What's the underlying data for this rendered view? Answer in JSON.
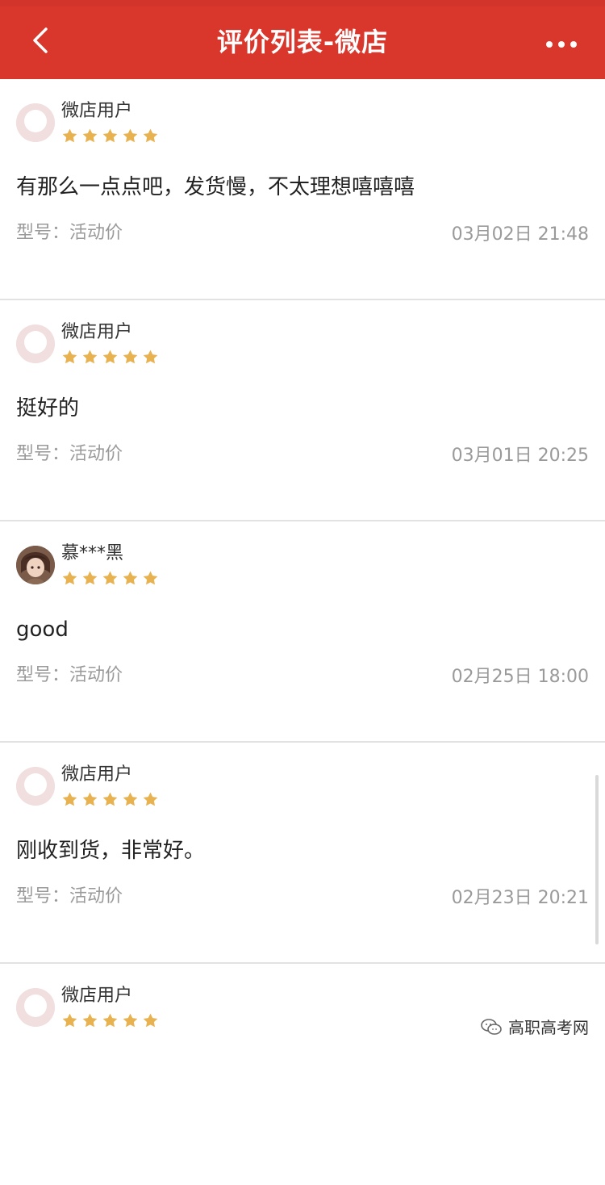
{
  "header": {
    "title": "评价列表-微店",
    "back_icon": "chevron-left-icon",
    "more_icon": "more-horizontal-icon",
    "bg_color": "#d9362c"
  },
  "reviews": [
    {
      "username": "微店用户",
      "rating": 5,
      "content": "有那么一点点吧，发货慢，不太理想嘻嘻嘻",
      "model": "型号：活动价",
      "date": "03月02日 21:48",
      "avatar": "default-avatar"
    },
    {
      "username": "微店用户",
      "rating": 5,
      "content": "挺好的",
      "model": "型号：活动价",
      "date": "03月01日 20:25",
      "avatar": "default-avatar"
    },
    {
      "username": "慕***黑",
      "rating": 5,
      "content": "good",
      "model": "型号：活动价",
      "date": "02月25日 18:00",
      "avatar": "photo-avatar"
    },
    {
      "username": "微店用户",
      "rating": 5,
      "content": "刚收到货，非常好。",
      "model": "型号：活动价",
      "date": "02月23日 20:21",
      "avatar": "default-avatar"
    },
    {
      "username": "微店用户",
      "rating": 5,
      "content": "",
      "model": "",
      "date": "",
      "avatar": "default-avatar"
    }
  ],
  "watermark": {
    "text": "高职高考网",
    "icon": "wechat-icon"
  },
  "colors": {
    "star": "#e7b24f",
    "meta": "#9a9a9a"
  }
}
